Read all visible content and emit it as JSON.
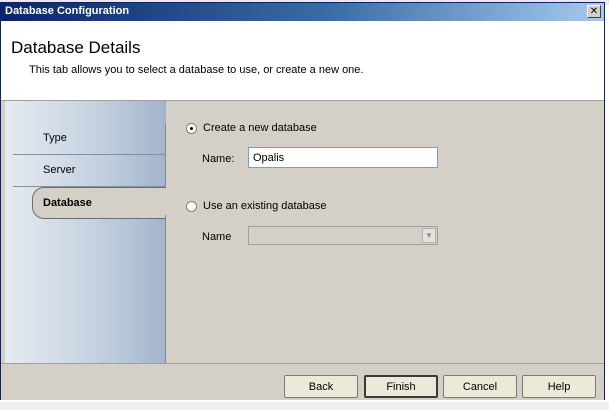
{
  "window": {
    "title": "Database Configuration",
    "close_glyph": "✕"
  },
  "header": {
    "title": "Database Details",
    "description": "This tab allows you to select a database to use, or create a new one."
  },
  "sidebar": {
    "items": [
      {
        "label": "Type"
      },
      {
        "label": "Server"
      },
      {
        "label": "Database",
        "selected": true
      }
    ]
  },
  "form": {
    "create_option": {
      "label": "Create a new database",
      "checked": true
    },
    "create_name_label": "Name:",
    "create_name_value": "Opalis",
    "existing_option": {
      "label": "Use an existing database",
      "checked": false
    },
    "existing_name_label": "Name",
    "existing_name_value": "",
    "dropdown_arrow": "▼"
  },
  "buttons": {
    "back": "Back",
    "finish": "Finish",
    "cancel": "Cancel",
    "help": "Help"
  }
}
